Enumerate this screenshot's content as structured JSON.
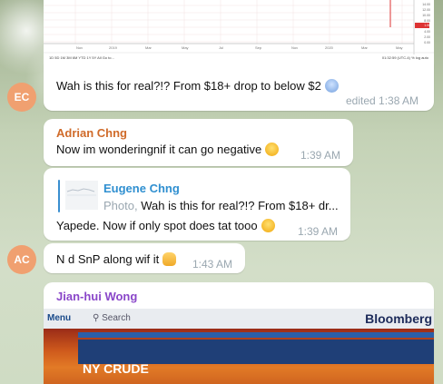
{
  "chart_image": {
    "x_ticks": [
      "Nov",
      "2019",
      "Mar",
      "May",
      "Jul",
      "Sep",
      "Nov",
      "2020",
      "Mar",
      "May"
    ],
    "range_buttons": "1D  5D  1M  3M  6M  YTD  1Y  5Y  All     Go to...",
    "right_controls": "01:32:59 (UTC-4)     %   log   auto",
    "y_ticks": [
      "14.00",
      "12.00",
      "10.00",
      "8.00",
      "6.00",
      "4.00",
      "2.00",
      "0.00",
      "-2.00"
    ],
    "price_badge": "1.06"
  },
  "messages": [
    {
      "avatar": "EC",
      "text": "Wah is this for real?!? From $18+ drop to below $2",
      "time": "edited 1:38 AM"
    },
    {
      "sender": "Adrian Chng",
      "text": "Now im wonderingnif it can go negative",
      "time": "1:39 AM"
    },
    {
      "quote_sender": "Eugene Chng",
      "quote_label": "Photo,",
      "quote_text": "Wah is this for real?!? From $18+ dr...",
      "text": "Yapede. Now if only spot does tat tooo",
      "time": "1:39 AM"
    },
    {
      "avatar": "AC",
      "text": "N d SnP along wif it",
      "time": "1:43 AM"
    },
    {
      "sender": "Jian-hui Wong"
    }
  ],
  "bloomberg_image": {
    "menu": "Menu",
    "search": "Search",
    "logo": "Bloomberg",
    "headline": "NY CRUDE"
  },
  "colors": {
    "avatar_bg": "#f0a070",
    "adrian_name": "#d06b2a",
    "eugene_name": "#2f8fd0",
    "jianhui_name": "#8a47c9",
    "time": "#9aa7b0"
  }
}
